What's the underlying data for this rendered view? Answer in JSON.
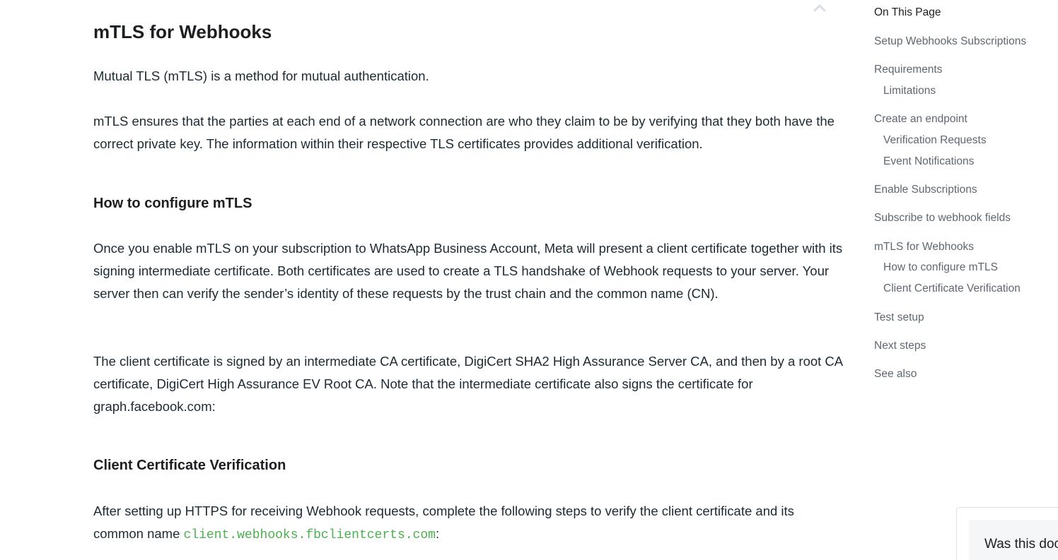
{
  "article": {
    "title": "mTLS for Webhooks",
    "intro_1": "Mutual TLS (mTLS) is a method for mutual authentication.",
    "intro_2": "mTLS ensures that the parties at each end of a network connection are who they claim to be by verifying that they both have the correct private key. The information within their respective TLS certificates provides additional verification.",
    "section_configure": {
      "heading": "How to configure mTLS",
      "para_1": "Once you enable mTLS on your subscription to WhatsApp Business Account, Meta will present a client certificate together with its signing intermediate certificate. Both certificates are used to create a TLS handshake of Webhook requests to your server. Your server then can verify the sender’s identity of these requests by the trust chain and the common name (CN).",
      "para_2": "The client certificate is signed by an intermediate CA certificate, DigiCert SHA2 High Assurance Server CA, and then by a root CA certificate, DigiCert High Assurance EV Root CA. Note that the intermediate certificate also signs the certificate for graph.facebook.com:"
    },
    "section_verification": {
      "heading": "Client Certificate Verification",
      "para_prefix": "After setting up HTTPS for receiving Webhook requests, complete the following steps to verify the client certificate and its common name ",
      "common_name": "client.webhooks.fbclientcerts.com",
      "para_suffix": ":"
    }
  },
  "toc": {
    "title": "On This Page",
    "items": [
      {
        "label": "Setup Webhooks Subscriptions",
        "level": 1
      },
      {
        "label": "Requirements",
        "level": 1
      },
      {
        "label": "Limitations",
        "level": 2
      },
      {
        "label": "Create an endpoint",
        "level": 1
      },
      {
        "label": "Verification Requests",
        "level": 2
      },
      {
        "label": "Event Notifications",
        "level": 2
      },
      {
        "label": "Enable Subscriptions",
        "level": 1
      },
      {
        "label": "Subscribe to webhook fields",
        "level": 1
      },
      {
        "label": "mTLS for Webhooks",
        "level": 1
      },
      {
        "label": "How to configure mTLS",
        "level": 2
      },
      {
        "label": "Client Certificate Verification",
        "level": 2
      },
      {
        "label": "Test setup",
        "level": 1
      },
      {
        "label": "Next steps",
        "level": 1
      },
      {
        "label": "See also",
        "level": 1
      }
    ]
  },
  "feedback": {
    "prompt": "Was this doc"
  },
  "colors": {
    "code_green": "#4caf50",
    "toc_text": "#606770",
    "body_text": "#1c2b33"
  },
  "icons": {
    "scroll_up": "chevron-up-icon"
  }
}
